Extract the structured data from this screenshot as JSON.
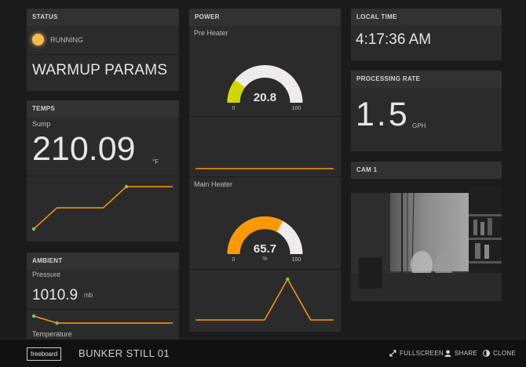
{
  "status": {
    "title": "STATUS",
    "indicator_text": "RUNNING",
    "indicator_color": "#f8b954",
    "params_text": "WARMUP PARAMS"
  },
  "temps": {
    "title": "TEMPS",
    "label": "Sump",
    "value": "210.09",
    "units": "°F",
    "sparkline": [
      1,
      3,
      3,
      3,
      5,
      5,
      5
    ]
  },
  "ambient": {
    "title": "AMBIENT",
    "pressure_label": "Pressure",
    "pressure_value": "1010.9",
    "pressure_units": "mb",
    "sparkline": [
      3,
      1,
      1,
      1,
      1,
      1,
      1
    ],
    "temperature_label": "Temperature"
  },
  "power": {
    "title": "POWER",
    "pre_heater": {
      "label": "Pre Heater",
      "value": 20.8,
      "value_text": "20.8",
      "min": "0",
      "max": "100",
      "color": "#d2d600",
      "sparkline": [
        1,
        1,
        1,
        1,
        1,
        1,
        1
      ]
    },
    "main_heater": {
      "label": "Main Heater",
      "value": 65.7,
      "value_text": "65.7",
      "units": "%",
      "min": "0",
      "max": "100",
      "color": "#ff9900",
      "sparkline": [
        1,
        1,
        1,
        1,
        5,
        1,
        1
      ]
    }
  },
  "local_time": {
    "title": "LOCAL TIME",
    "value": "4:17:36 AM"
  },
  "processing_rate": {
    "title": "PROCESSING RATE",
    "value": "1.5",
    "units": "GPH"
  },
  "cam": {
    "title": "CAM 1"
  },
  "footer": {
    "logo": "freeboard",
    "dashboard_title": "BUNKER STILL 01",
    "fullscreen": "FULLSCREEN",
    "share": "SHARE",
    "clone": "CLONE"
  },
  "colors": {
    "accent": "#ff9900",
    "gauge_track": "#edebeb",
    "spark_dot": "#7ec35b"
  }
}
